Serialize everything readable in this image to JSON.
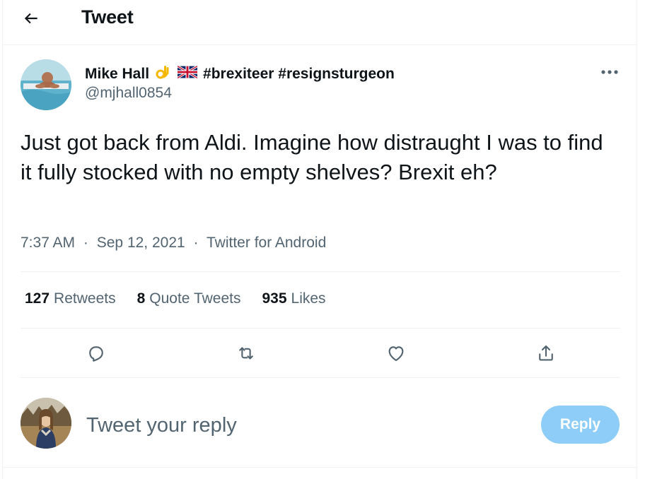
{
  "header": {
    "title": "Tweet",
    "back_icon": "arrow-left-icon"
  },
  "tweet": {
    "author_name": "Mike Hall",
    "author_name_emojis": [
      "ok-hand-emoji",
      "uk-flag-emoji"
    ],
    "author_hashtags": "#brexiteer #resignsturgeon",
    "author_handle": "@mjhall0854",
    "text": "Just got back from Aldi. Imagine how distraught I was to find it fully stocked with no empty shelves? Brexit eh?",
    "time": "7:37 AM",
    "date": "Sep 12, 2021",
    "source": "Twitter for Android",
    "separator": "·"
  },
  "stats": {
    "retweets_count": "127",
    "retweets_label": "Retweets",
    "quotes_count": "8",
    "quotes_label": "Quote Tweets",
    "likes_count": "935",
    "likes_label": "Likes"
  },
  "actions": [
    "reply-icon",
    "retweet-icon",
    "like-icon",
    "share-icon"
  ],
  "reply": {
    "placeholder": "Tweet your reply",
    "button_label": "Reply",
    "button_color": "#8ecdf8"
  },
  "colors": {
    "text_primary": "#0f1419",
    "text_secondary": "#536471",
    "divider": "#eff3f4"
  }
}
